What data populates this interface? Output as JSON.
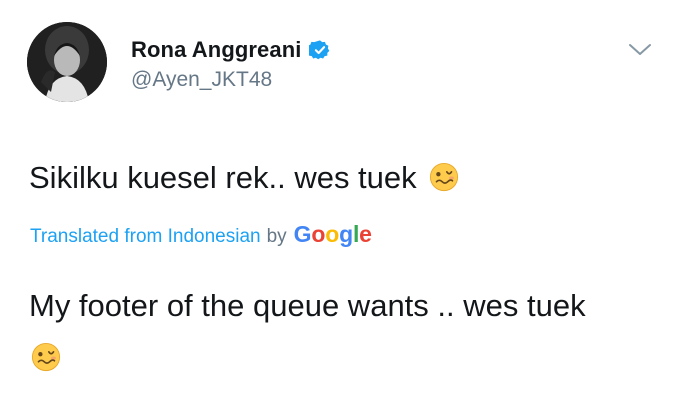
{
  "tweet": {
    "user": {
      "display_name": "Rona Anggreani",
      "handle": "@Ayen_JKT48",
      "verified": true,
      "avatar_icon": "avatar-photo"
    },
    "menu_icon": "chevron-down-icon",
    "text": "Sikilku kuesel rek.. wes tuek",
    "text_emoji": "woozy-face-emoji",
    "translation": {
      "label": "Translated from Indonesian",
      "by": "by",
      "provider": "Google",
      "provider_letters": [
        "G",
        "o",
        "o",
        "g",
        "l",
        "e"
      ],
      "text": "My footer of the queue wants .. wes tuek",
      "text_emoji": "woozy-face-emoji"
    }
  },
  "colors": {
    "text": "#14171a",
    "secondary": "#657786",
    "link": "#1da1f2",
    "verified": "#1da1f2",
    "google_blue": "#4285f4",
    "google_red": "#ea4335",
    "google_yellow": "#fbbc05",
    "google_green": "#34a853"
  }
}
